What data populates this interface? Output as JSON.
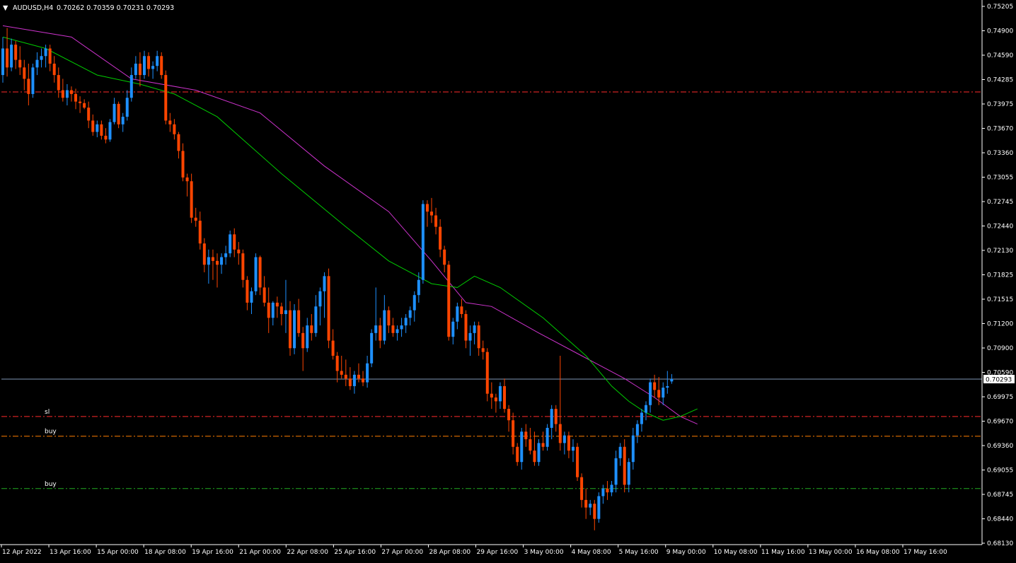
{
  "chart_header": {
    "symbol_timeframe": "AUDUSD,H4",
    "ohlc": "0.70262 0.70359 0.70231 0.70293",
    "menu_glyph": "▼"
  },
  "colors": {
    "background": "#000000",
    "bull_candle": "#1e90ff",
    "bear_candle": "#ff4500",
    "ma_fast": "#00cc00",
    "ma_slow": "#cc33cc",
    "bid_line": "#7f96b4",
    "sl_line": "#ff2a2a",
    "buy_line_upper": "#ff7f00",
    "buy_line_lower": "#22aa22",
    "axis_text": "#ffffff",
    "axis_line": "#ffffff",
    "price_label_bg": "#ffffff",
    "price_label_text": "#000000"
  },
  "chart_data": {
    "type": "candlestick",
    "ylim": [
      0.6813,
      0.75205
    ],
    "y_ticks": [
      "0.75205",
      "0.74900",
      "0.74590",
      "0.74285",
      "0.73975",
      "0.73670",
      "0.73360",
      "0.73055",
      "0.72745",
      "0.72440",
      "0.72130",
      "0.71825",
      "0.71515",
      "0.71200",
      "0.70900",
      "0.70590",
      "0.70293",
      "0.69975",
      "0.69670",
      "0.69360",
      "0.69055",
      "0.68745",
      "0.68440",
      "0.68130"
    ],
    "x_ticks": [
      "12 Apr 2022",
      "13 Apr 16:00",
      "15 Apr 00:00",
      "18 Apr 08:00",
      "19 Apr 16:00",
      "21 Apr 00:00",
      "22 Apr 08:00",
      "25 Apr 16:00",
      "27 Apr 00:00",
      "28 Apr 08:00",
      "29 Apr 16:00",
      "3 May 00:00",
      "4 May 08:00",
      "5 May 16:00",
      "9 May 00:00",
      "10 May 08:00",
      "11 May 16:00",
      "13 May 00:00",
      "16 May 08:00",
      "17 May 16:00"
    ],
    "current_price": "0.70293",
    "horizontal_lines": [
      {
        "label": "",
        "price": 0.74077,
        "style": "dashdot",
        "color": "#ff2a2a"
      },
      {
        "label": "sl",
        "price": 0.698,
        "style": "dashdot",
        "color": "#ff2a2a"
      },
      {
        "label": "buy",
        "price": 0.6954,
        "style": "dashdot",
        "color": "#ff7f00"
      },
      {
        "label": "buy",
        "price": 0.6885,
        "style": "dashdot",
        "color": "#22aa22"
      }
    ],
    "candles": [
      [
        0.743,
        0.748,
        0.742,
        0.7465
      ],
      [
        0.7465,
        0.7492,
        0.7428,
        0.744
      ],
      [
        0.744,
        0.7478,
        0.7435,
        0.747
      ],
      [
        0.747,
        0.7475,
        0.7438,
        0.745
      ],
      [
        0.745,
        0.7468,
        0.743,
        0.744
      ],
      [
        0.744,
        0.745,
        0.741,
        0.7425
      ],
      [
        0.7425,
        0.7445,
        0.739,
        0.7405
      ],
      [
        0.7405,
        0.7445,
        0.74,
        0.744
      ],
      [
        0.744,
        0.746,
        0.743,
        0.745
      ],
      [
        0.745,
        0.7465,
        0.744,
        0.7455
      ],
      [
        0.7455,
        0.747,
        0.744,
        0.7465
      ],
      [
        0.7465,
        0.747,
        0.7435,
        0.7445
      ],
      [
        0.7445,
        0.7455,
        0.742,
        0.743
      ],
      [
        0.743,
        0.744,
        0.74,
        0.741
      ],
      [
        0.741,
        0.7425,
        0.7395,
        0.74
      ],
      [
        0.74,
        0.7418,
        0.739,
        0.741
      ],
      [
        0.741,
        0.7415,
        0.7395,
        0.7405
      ],
      [
        0.7405,
        0.7412,
        0.7385,
        0.7395
      ],
      [
        0.7395,
        0.7402,
        0.738,
        0.7393
      ],
      [
        0.7393,
        0.7398,
        0.7385,
        0.7387
      ],
      [
        0.7387,
        0.7395,
        0.736,
        0.737
      ],
      [
        0.737,
        0.7378,
        0.735,
        0.7355
      ],
      [
        0.7355,
        0.737,
        0.7348,
        0.7365
      ],
      [
        0.7365,
        0.737,
        0.7345,
        0.735
      ],
      [
        0.735,
        0.736,
        0.734,
        0.7345
      ],
      [
        0.7345,
        0.7372,
        0.7342,
        0.7368
      ],
      [
        0.7368,
        0.74,
        0.7365,
        0.7392
      ],
      [
        0.7392,
        0.7395,
        0.736,
        0.7365
      ],
      [
        0.7365,
        0.738,
        0.7355,
        0.7375
      ],
      [
        0.7375,
        0.741,
        0.737,
        0.74
      ],
      [
        0.74,
        0.744,
        0.7395,
        0.743
      ],
      [
        0.743,
        0.7455,
        0.7425,
        0.7445
      ],
      [
        0.7445,
        0.746,
        0.7415,
        0.743
      ],
      [
        0.743,
        0.7462,
        0.7425,
        0.7455
      ],
      [
        0.7455,
        0.746,
        0.7428,
        0.7438
      ],
      [
        0.7438,
        0.7448,
        0.7425,
        0.7442
      ],
      [
        0.7442,
        0.7462,
        0.7435,
        0.7455
      ],
      [
        0.7455,
        0.746,
        0.7425,
        0.743
      ],
      [
        0.743,
        0.7436,
        0.7365,
        0.737
      ],
      [
        0.737,
        0.738,
        0.7355,
        0.7365
      ],
      [
        0.7365,
        0.7372,
        0.7345,
        0.7352
      ],
      [
        0.7352,
        0.7355,
        0.732,
        0.733
      ],
      [
        0.733,
        0.734,
        0.729,
        0.7295
      ],
      [
        0.7295,
        0.73,
        0.727,
        0.729
      ],
      [
        0.729,
        0.73,
        0.7235,
        0.7242
      ],
      [
        0.7242,
        0.7255,
        0.723,
        0.7238
      ],
      [
        0.7238,
        0.725,
        0.72,
        0.7208
      ],
      [
        0.7208,
        0.7215,
        0.717,
        0.718
      ],
      [
        0.718,
        0.72,
        0.7155,
        0.719
      ],
      [
        0.719,
        0.72,
        0.716,
        0.7185
      ],
      [
        0.7185,
        0.7195,
        0.715,
        0.718
      ],
      [
        0.718,
        0.7195,
        0.7168,
        0.719
      ],
      [
        0.719,
        0.7205,
        0.718,
        0.7195
      ],
      [
        0.7195,
        0.7225,
        0.719,
        0.722
      ],
      [
        0.722,
        0.7228,
        0.719,
        0.72
      ],
      [
        0.72,
        0.721,
        0.718,
        0.7195
      ],
      [
        0.7195,
        0.72,
        0.715,
        0.716
      ],
      [
        0.716,
        0.7165,
        0.712,
        0.713
      ],
      [
        0.713,
        0.715,
        0.7115,
        0.7145
      ],
      [
        0.7145,
        0.7195,
        0.714,
        0.719
      ],
      [
        0.719,
        0.7192,
        0.714,
        0.715
      ],
      [
        0.715,
        0.7165,
        0.7125,
        0.713
      ],
      [
        0.713,
        0.715,
        0.709,
        0.711
      ],
      [
        0.711,
        0.7132,
        0.71,
        0.713
      ],
      [
        0.713,
        0.7138,
        0.711,
        0.7125
      ],
      [
        0.7125,
        0.713,
        0.71,
        0.7115
      ],
      [
        0.7115,
        0.716,
        0.709,
        0.712
      ],
      [
        0.712,
        0.7132,
        0.706,
        0.707
      ],
      [
        0.707,
        0.7128,
        0.7062,
        0.712
      ],
      [
        0.712,
        0.7135,
        0.7085,
        0.709
      ],
      [
        0.709,
        0.7098,
        0.704,
        0.707
      ],
      [
        0.707,
        0.711,
        0.7065,
        0.71
      ],
      [
        0.71,
        0.7115,
        0.708,
        0.709
      ],
      [
        0.709,
        0.714,
        0.7085,
        0.7125
      ],
      [
        0.7125,
        0.715,
        0.71,
        0.7145
      ],
      [
        0.7145,
        0.717,
        0.711,
        0.7165
      ],
      [
        0.7165,
        0.7175,
        0.707,
        0.708
      ],
      [
        0.708,
        0.7095,
        0.7055,
        0.706
      ],
      [
        0.706,
        0.7065,
        0.7025,
        0.704
      ],
      [
        0.704,
        0.706,
        0.703,
        0.7035
      ],
      [
        0.7035,
        0.7055,
        0.702,
        0.703
      ],
      [
        0.703,
        0.7045,
        0.7015,
        0.702
      ],
      [
        0.702,
        0.704,
        0.701,
        0.7035
      ],
      [
        0.7035,
        0.705,
        0.7025,
        0.703
      ],
      [
        0.703,
        0.704,
        0.702,
        0.7025
      ],
      [
        0.7025,
        0.706,
        0.7018,
        0.705
      ],
      [
        0.705,
        0.7095,
        0.7045,
        0.709
      ],
      [
        0.709,
        0.715,
        0.708,
        0.71
      ],
      [
        0.71,
        0.711,
        0.707,
        0.708
      ],
      [
        0.708,
        0.714,
        0.7075,
        0.712
      ],
      [
        0.712,
        0.7125,
        0.709,
        0.71
      ],
      [
        0.71,
        0.711,
        0.7085,
        0.709
      ],
      [
        0.709,
        0.71,
        0.708,
        0.7095
      ],
      [
        0.7095,
        0.711,
        0.7085,
        0.71
      ],
      [
        0.71,
        0.7115,
        0.709,
        0.711
      ],
      [
        0.711,
        0.7125,
        0.71,
        0.712
      ],
      [
        0.712,
        0.7145,
        0.7105,
        0.714
      ],
      [
        0.714,
        0.717,
        0.713,
        0.716
      ],
      [
        0.716,
        0.7265,
        0.7155,
        0.726
      ],
      [
        0.726,
        0.7265,
        0.723,
        0.725
      ],
      [
        0.725,
        0.7268,
        0.7235,
        0.7245
      ],
      [
        0.7245,
        0.7255,
        0.722,
        0.723
      ],
      [
        0.723,
        0.724,
        0.719,
        0.72
      ],
      [
        0.72,
        0.7205,
        0.717,
        0.718
      ],
      [
        0.718,
        0.7185,
        0.708,
        0.7085
      ],
      [
        0.7085,
        0.711,
        0.7075,
        0.7105
      ],
      [
        0.7105,
        0.713,
        0.7095,
        0.7125
      ],
      [
        0.7125,
        0.7135,
        0.711,
        0.7115
      ],
      [
        0.7115,
        0.712,
        0.707,
        0.708
      ],
      [
        0.708,
        0.71,
        0.706,
        0.709
      ],
      [
        0.709,
        0.7105,
        0.7075,
        0.71
      ],
      [
        0.71,
        0.7105,
        0.706,
        0.707
      ],
      [
        0.707,
        0.708,
        0.7055,
        0.7065
      ],
      [
        0.7065,
        0.707,
        0.7,
        0.701
      ],
      [
        0.701,
        0.7025,
        0.699,
        0.7005
      ],
      [
        0.7005,
        0.701,
        0.6985,
        0.7
      ],
      [
        0.7,
        0.7025,
        0.699,
        0.702
      ],
      [
        0.702,
        0.703,
        0.6985,
        0.699
      ],
      [
        0.699,
        0.6995,
        0.696,
        0.6975
      ],
      [
        0.6975,
        0.6985,
        0.693,
        0.694
      ],
      [
        0.694,
        0.6945,
        0.6915,
        0.692
      ],
      [
        0.692,
        0.6965,
        0.691,
        0.696
      ],
      [
        0.696,
        0.697,
        0.694,
        0.695
      ],
      [
        0.695,
        0.6965,
        0.693,
        0.6935
      ],
      [
        0.6935,
        0.696,
        0.6915,
        0.692
      ],
      [
        0.692,
        0.695,
        0.6915,
        0.6945
      ],
      [
        0.6945,
        0.696,
        0.6935,
        0.694
      ],
      [
        0.694,
        0.697,
        0.6935,
        0.6965
      ],
      [
        0.6965,
        0.6995,
        0.695,
        0.699
      ],
      [
        0.699,
        0.6995,
        0.696,
        0.697
      ],
      [
        0.697,
        0.706,
        0.6935,
        0.6945
      ],
      [
        0.6945,
        0.696,
        0.693,
        0.6955
      ],
      [
        0.6955,
        0.696,
        0.6925,
        0.6935
      ],
      [
        0.6935,
        0.695,
        0.692,
        0.694
      ],
      [
        0.694,
        0.6945,
        0.6895,
        0.69
      ],
      [
        0.69,
        0.6905,
        0.686,
        0.687
      ],
      [
        0.687,
        0.6885,
        0.6845,
        0.686
      ],
      [
        0.686,
        0.687,
        0.685,
        0.6865
      ],
      [
        0.6865,
        0.687,
        0.683,
        0.6845
      ],
      [
        0.6845,
        0.688,
        0.684,
        0.6875
      ],
      [
        0.6875,
        0.689,
        0.6865,
        0.6885
      ],
      [
        0.6885,
        0.6895,
        0.687,
        0.688
      ],
      [
        0.688,
        0.6895,
        0.6875,
        0.689
      ],
      [
        0.689,
        0.6935,
        0.688,
        0.6925
      ],
      [
        0.6925,
        0.6945,
        0.6915,
        0.694
      ],
      [
        0.694,
        0.695,
        0.688,
        0.689
      ],
      [
        0.689,
        0.6925,
        0.688,
        0.692
      ],
      [
        0.692,
        0.6965,
        0.691,
        0.6955
      ],
      [
        0.6955,
        0.6975,
        0.6945,
        0.697
      ],
      [
        0.697,
        0.699,
        0.696,
        0.6985
      ],
      [
        0.6985,
        0.7,
        0.6975,
        0.6995
      ],
      [
        0.6995,
        0.703,
        0.6985,
        0.7025
      ],
      [
        0.7025,
        0.7035,
        0.7005,
        0.7015
      ],
      [
        0.7015,
        0.7032,
        0.6995,
        0.7005
      ],
      [
        0.7005,
        0.7025,
        0.6995,
        0.7018
      ],
      [
        0.7018,
        0.704,
        0.701,
        0.702
      ],
      [
        0.70262,
        0.70359,
        0.70231,
        0.70293
      ]
    ],
    "ma_fast_points": [
      [
        0,
        0.748
      ],
      [
        10,
        0.7465
      ],
      [
        22,
        0.743
      ],
      [
        32,
        0.7418
      ],
      [
        40,
        0.7405
      ],
      [
        50,
        0.7375
      ],
      [
        65,
        0.73
      ],
      [
        80,
        0.723
      ],
      [
        90,
        0.7185
      ],
      [
        100,
        0.7155
      ],
      [
        106,
        0.715
      ],
      [
        110,
        0.7165
      ],
      [
        116,
        0.715
      ],
      [
        126,
        0.711
      ],
      [
        136,
        0.706
      ],
      [
        142,
        0.702
      ],
      [
        146,
        0.7
      ],
      [
        150,
        0.6985
      ],
      [
        154,
        0.6975
      ],
      [
        158,
        0.698
      ],
      [
        162,
        0.699
      ]
    ],
    "ma_slow_points": [
      [
        0,
        0.7495
      ],
      [
        16,
        0.748
      ],
      [
        30,
        0.7425
      ],
      [
        45,
        0.741
      ],
      [
        60,
        0.738
      ],
      [
        75,
        0.731
      ],
      [
        90,
        0.725
      ],
      [
        100,
        0.7185
      ],
      [
        108,
        0.713
      ],
      [
        114,
        0.7125
      ],
      [
        125,
        0.709
      ],
      [
        135,
        0.706
      ],
      [
        145,
        0.703
      ],
      [
        152,
        0.7005
      ],
      [
        158,
        0.698
      ],
      [
        162,
        0.697
      ]
    ]
  }
}
